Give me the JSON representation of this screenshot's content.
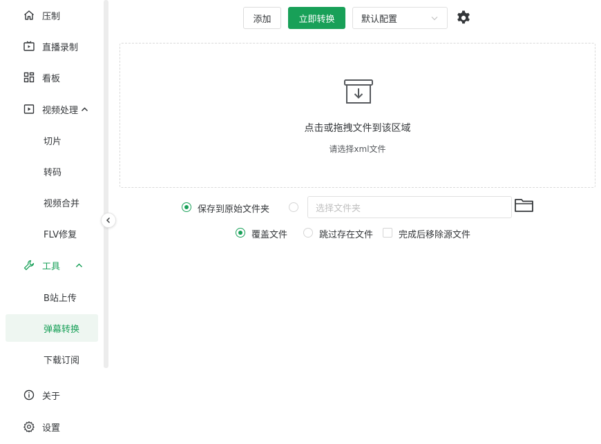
{
  "sidebar": {
    "items": [
      {
        "label": "压制",
        "icon": "home-icon"
      },
      {
        "label": "直播录制",
        "icon": "live-tv-icon"
      },
      {
        "label": "看板",
        "icon": "dashboard-icon"
      },
      {
        "label": "视频处理",
        "icon": "video-play-icon"
      },
      {
        "label": "切片"
      },
      {
        "label": "转码"
      },
      {
        "label": "视频合并"
      },
      {
        "label": "FLV修复"
      },
      {
        "label": "工具",
        "icon": "wrench-icon"
      },
      {
        "label": "B站上传"
      },
      {
        "label": "弹幕转换"
      },
      {
        "label": "下载订阅"
      },
      {
        "label": "关于",
        "icon": "info-icon"
      },
      {
        "label": "设置",
        "icon": "gear-icon"
      }
    ],
    "active_item": "弹幕转换"
  },
  "toolbar": {
    "add_label": "添加",
    "convert_label": "立即转换",
    "preset_value": "默认配置"
  },
  "dropzone": {
    "title": "点击或拖拽文件到该区域",
    "hint": "请选择xml文件"
  },
  "output": {
    "save_original_label": "保存到原始文件夹",
    "folder_placeholder": "选择文件夹",
    "overwrite_label": "覆盖文件",
    "skip_label": "跳过存在文件",
    "remove_source_label": "完成后移除源文件"
  },
  "colors": {
    "accent": "#18a058",
    "active_bg": "#eef6f1"
  }
}
